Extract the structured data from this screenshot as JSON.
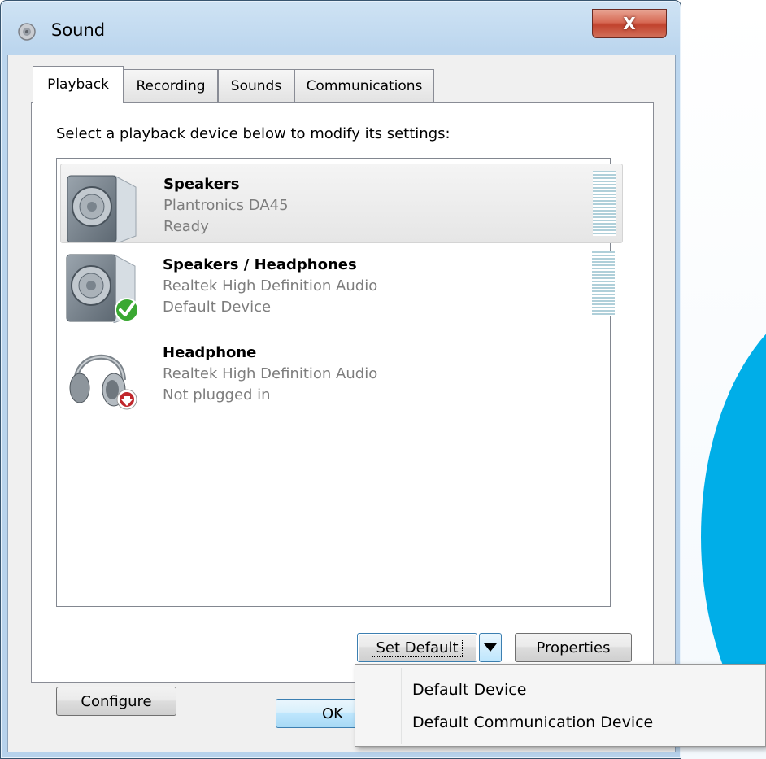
{
  "window": {
    "title": "Sound",
    "close_glyph": "X"
  },
  "tabs": [
    {
      "label": "Playback",
      "active": true
    },
    {
      "label": "Recording",
      "active": false
    },
    {
      "label": "Sounds",
      "active": false
    },
    {
      "label": "Communications",
      "active": false
    }
  ],
  "playback": {
    "instruction": "Select a playback device below to modify its settings:",
    "devices": [
      {
        "name": "Speakers",
        "driver": "Plantronics DA45",
        "status": "Ready",
        "icon": "speaker-icon",
        "selected": true,
        "meter": true
      },
      {
        "name": "Speakers / Headphones",
        "driver": "Realtek High Definition Audio",
        "status": "Default Device",
        "icon": "speaker-default-icon",
        "selected": false,
        "meter": true
      },
      {
        "name": "Headphone",
        "driver": "Realtek High Definition Audio",
        "status": "Not plugged in",
        "icon": "headphone-unplugged-icon",
        "selected": false,
        "meter": false
      }
    ]
  },
  "buttons": {
    "configure": "Configure",
    "set_default": "Set Default",
    "properties": "Properties",
    "ok": "OK"
  },
  "set_default_menu": {
    "items": [
      "Default Device",
      "Default Communication Device"
    ]
  },
  "colors": {
    "accent_blue": "#00aee8",
    "secondary_text": "#7d7d7d",
    "default_check": "#3aa832",
    "unplugged_arrow": "#c0262b"
  }
}
